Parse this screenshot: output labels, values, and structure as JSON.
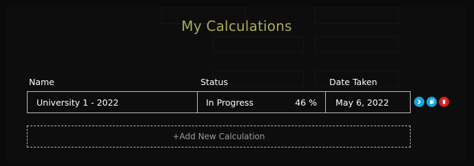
{
  "page": {
    "title": "My Calculations"
  },
  "table": {
    "headers": {
      "name": "Name",
      "status": "Status",
      "date": "Date Taken"
    },
    "rows": [
      {
        "name": "University 1 - 2022",
        "status": "In Progress",
        "progress": "46 %",
        "date": "May 6, 2022"
      }
    ]
  },
  "actions": {
    "open_icon": "chevron-right-icon",
    "copy_icon": "copy-icon",
    "delete_icon": "trash-icon"
  },
  "add_new": {
    "label": "+Add New Calculation"
  },
  "colors": {
    "title": "#a9ad5a",
    "action_blue": "#1aa4d8",
    "action_red": "#d41f1f",
    "border": "#bfbfbf"
  }
}
